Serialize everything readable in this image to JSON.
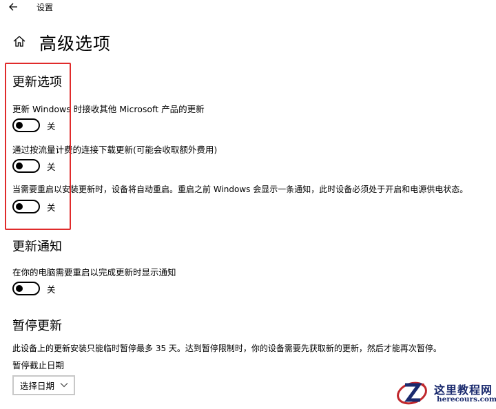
{
  "window": {
    "app_title": "设置"
  },
  "page": {
    "title": "高级选项"
  },
  "update_options": {
    "title": "更新选项",
    "settings": [
      {
        "label": "更新 Windows 时接收其他 Microsoft 产品的更新",
        "state": "关"
      },
      {
        "label": "通过按流量计费的连接下载更新(可能会收取额外费用)",
        "state": "关"
      },
      {
        "label": "当需要重启以安装更新时，设备将自动重启。重启之前 Windows 会显示一条通知，此时设备必须处于开启和电源供电状态。",
        "state": "关"
      }
    ]
  },
  "update_notifications": {
    "title": "更新通知",
    "settings": [
      {
        "label": "在你的电脑需要重启以完成更新时显示通知",
        "state": "关"
      }
    ]
  },
  "pause_updates": {
    "title": "暂停更新",
    "description": "此设备上的更新安装只能临时暂停最多 35 天。达到暂停限制时，你的设备需要先获取新的更新，然后才能再次暂停。",
    "date_label": "暂停截止日期",
    "select_value": "选择日期"
  },
  "watermark": {
    "name": "这里教程网",
    "url": "herecours.com"
  },
  "colors": {
    "highlight_border": "#e02b2b",
    "toggle_off": "#000000",
    "watermark_text": "#1a2a6e"
  },
  "icons": {
    "back": "back-arrow-icon",
    "home": "home-icon",
    "dropdown": "chevron-down-icon"
  }
}
